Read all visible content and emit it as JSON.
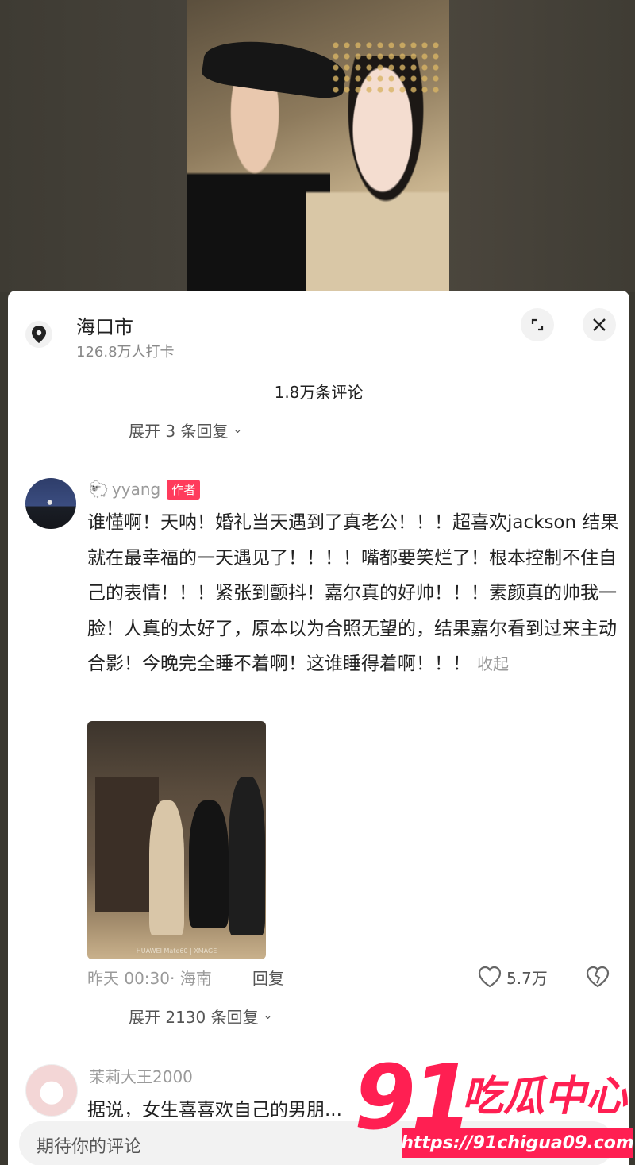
{
  "location": {
    "name": "海口市",
    "checkins": "126.8万人打卡"
  },
  "comments_header": {
    "count": "1.8万条评论"
  },
  "replies_top": {
    "label": "展开 3 条回复"
  },
  "comment1": {
    "username": "yyang",
    "badge": "作者",
    "text": "谁懂啊！天呐！婚礼当天遇到了真老公！！！超喜欢jackson 结果就在最幸福的一天遇见了！！！！嘴都要笑烂了！根本控制不住自己的表情！！！紧张到颤抖！嘉尔真的好帅！！！素颜真的帅我一脸！人真的太好了，原本以为合照无望的，结果嘉尔看到过来主动合影！今晚完全睡不着啊！这谁睡得着啊！！！",
    "collapse": "收起",
    "time_loc": "昨天 00:30· 海南",
    "reply": "回复",
    "likes": "5.7万",
    "photo_tag": "HUAWEI Mate60 | XMAGE"
  },
  "replies_mid": {
    "label": "展开 2130 条回复"
  },
  "comment2": {
    "username": "茉莉大王2000",
    "text": "据说，女生喜喜欢自己的男朋..."
  },
  "input": {
    "placeholder": "期待你的评论"
  },
  "watermark": {
    "number": "91",
    "title": "吃瓜中心",
    "url": "https://91chigua09.com"
  },
  "icons": {
    "location": "location-pin-icon",
    "expand": "expand-icon",
    "close": "close-icon",
    "like": "heart-icon",
    "dislike": "broken-heart-icon"
  }
}
